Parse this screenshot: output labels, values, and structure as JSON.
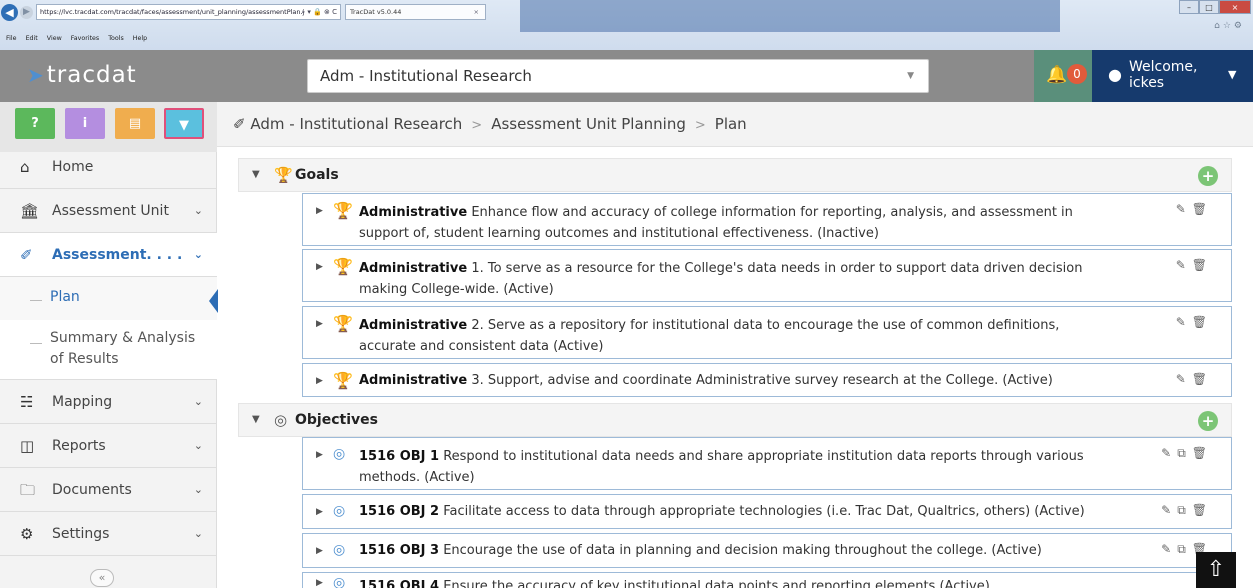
{
  "browser": {
    "url": "https://lvc.tracdat.com/tracdat/faces/assessment/unit_planning/assessmentPlan.j",
    "url_controls": "⌕ ▾ 🔒 ⊗ C",
    "tab_title": "TracDat v5.0.44",
    "menu": [
      "File",
      "Edit",
      "View",
      "Favorites",
      "Tools",
      "Help"
    ]
  },
  "app": {
    "logo": "tracdat",
    "institution": "Adm - Institutional Research",
    "notifications": "0",
    "welcome": "Welcome,",
    "username": "ickes"
  },
  "quick_buttons": [
    {
      "label": "?",
      "color": "#5cb85c"
    },
    {
      "label": "i",
      "color": "#b48ee0"
    },
    {
      "label": "▤",
      "color": "#f0ad4e"
    },
    {
      "label": "▼",
      "color": "#5bc0de"
    }
  ],
  "sidebar": {
    "items": [
      {
        "label": "Home",
        "icon": "home-icon"
      },
      {
        "label": "Assessment Unit",
        "icon": "institution-icon"
      },
      {
        "label": "Assessment. . . .",
        "icon": "pencil-icon"
      },
      {
        "label": "Mapping",
        "icon": "sitemap-icon"
      },
      {
        "label": "Reports",
        "icon": "columns-icon"
      },
      {
        "label": "Documents",
        "icon": "folder-icon"
      },
      {
        "label": "Settings",
        "icon": "gear-icon"
      }
    ],
    "sub_items": [
      "Plan",
      "Summary & Analysis of Results"
    ]
  },
  "breadcrumb": [
    "Adm - Institutional Research",
    "Assessment Unit Planning",
    "Plan"
  ],
  "goals": {
    "title": "Goals",
    "items": [
      {
        "bold": "Administrative",
        "text": " Enhance flow and accuracy of college information for reporting, analysis, and assessment in support of, student learning outcomes and institutional effectiveness. (Inactive)"
      },
      {
        "bold": "Administrative",
        "text": " 1. To serve as a resource for the College's data needs in order to support data driven decision making College-wide. (Active)"
      },
      {
        "bold": "Administrative",
        "text": " 2. Serve as a repository for institutional data to encourage the use of common definitions, accurate and consistent data (Active)"
      },
      {
        "bold": "Administrative",
        "text": " 3. Support, advise and coordinate Administrative survey research at the College. (Active)"
      }
    ]
  },
  "objectives": {
    "title": "Objectives",
    "items": [
      {
        "bold": "1516 OBJ 1",
        "text": " Respond to institutional data needs and share appropriate institution data reports through various methods. (Active)"
      },
      {
        "bold": "1516 OBJ 2",
        "text": " Facilitate access to data through appropriate technologies (i.e. Trac Dat, Qualtrics, others) (Active)"
      },
      {
        "bold": "1516 OBJ 3",
        "text": " Encourage the use of data in planning and decision making throughout the college. (Active)"
      },
      {
        "bold": "1516 OBJ 4",
        "text": " Ensure the accuracy of key institutional data points and reporting elements (Active)"
      }
    ]
  },
  "colors": {
    "accent": "#2d6db5",
    "header": "#8b8b8b",
    "user": "#163a6d",
    "notify": "#5a8f7b",
    "add": "#7cc576"
  }
}
